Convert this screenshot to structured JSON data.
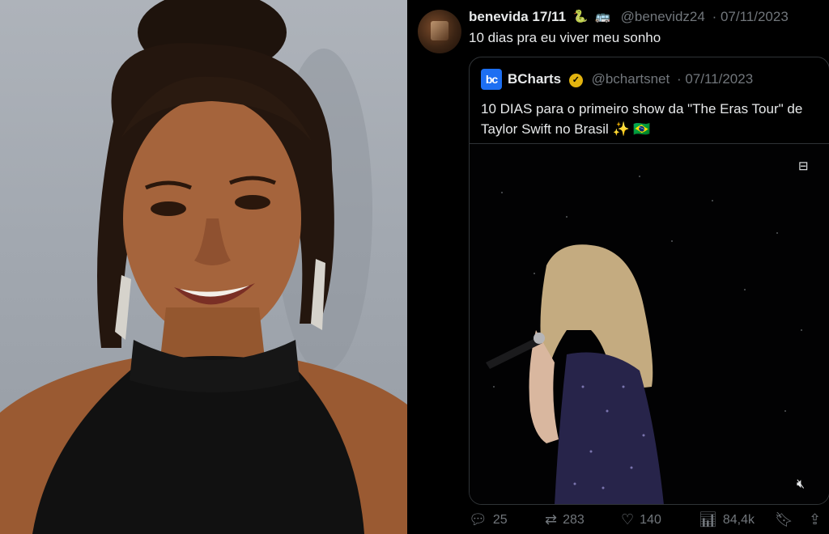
{
  "tweet": {
    "author_name": "benevida 17/11",
    "author_emojis": [
      "snake-emoji",
      "bus-emoji"
    ],
    "handle": "@benevidz24",
    "date": "· 07/11/2023",
    "text": "10 dias pra eu viver meu sonho"
  },
  "quoted": {
    "logo_text": "bc",
    "name": "BCharts",
    "verified_icon": "verified-badge-icon",
    "handle": "@bchartsnet",
    "date": "· 07/11/2023",
    "text": "10 DIAS para o primeiro show da \"The Eras Tour\" de Taylor Swift no Brasil ✨ 🇧🇷"
  },
  "actions": {
    "replies": "25",
    "retweets": "283",
    "likes": "140",
    "views": "84,4k"
  },
  "colors": {
    "background": "#000000",
    "text": "#e7e9ea",
    "muted": "#71767b",
    "border": "#2f3336",
    "logo": "#1d6ff2",
    "verified": "#e2b30f"
  }
}
